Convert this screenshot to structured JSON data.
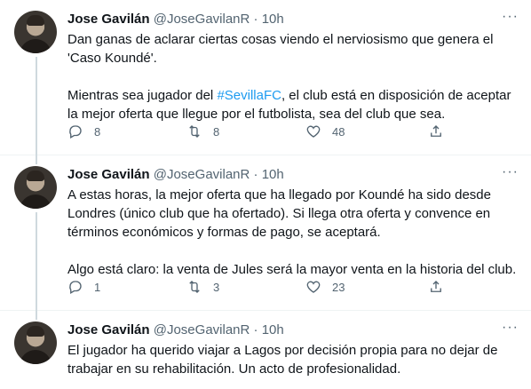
{
  "tweets": [
    {
      "name": "Jose Gavilán",
      "handle": "@JoseGavilanR",
      "sep": "·",
      "time": "10h",
      "p1": "Dan ganas de aclarar ciertas cosas viendo el nerviosismo que genera el 'Caso Koundé'.",
      "p2_before": "Mientras sea jugador del ",
      "p2_hashtag": "#SevillaFC",
      "p2_after": ", el club está en disposición de aceptar la mejor oferta que llegue por el futbolista, sea del club que sea.",
      "replies": "8",
      "retweets": "8",
      "likes": "48"
    },
    {
      "name": "Jose Gavilán",
      "handle": "@JoseGavilanR",
      "sep": "·",
      "time": "10h",
      "p1": "A estas horas, la mejor oferta que ha llegado por Koundé ha sido desde Londres (único club que ha ofertado). Si llega otra oferta y convence en términos económicos y formas de pago, se aceptará.",
      "p2": "Algo está claro: la venta de Jules será la mayor venta en la historia del club.",
      "replies": "1",
      "retweets": "3",
      "likes": "23"
    },
    {
      "name": "Jose Gavilán",
      "handle": "@JoseGavilanR",
      "sep": "·",
      "time": "10h",
      "p1": "El jugador ha querido viajar a Lagos por decisión propia para no dejar de trabajar en su rehabilitación. Un acto de profesionalidad."
    }
  ],
  "more_glyph": "···",
  "icons": [
    "reply-icon",
    "retweet-icon",
    "like-icon",
    "share-icon",
    "more-icon"
  ],
  "colors": {
    "hashtag": "#1d9bf0",
    "muted": "#536471",
    "text": "#0f1419"
  }
}
